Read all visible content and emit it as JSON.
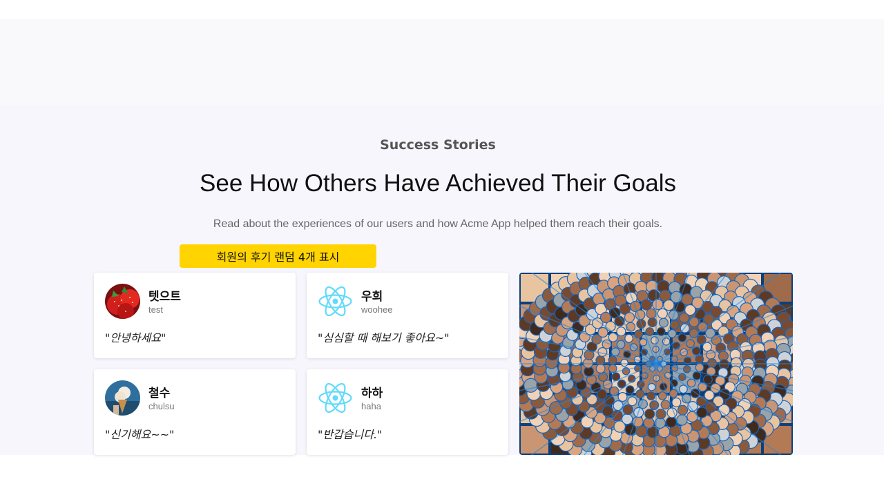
{
  "section": {
    "eyebrow": "Success Stories",
    "headline": "See How Others Have Achieved Their Goals",
    "lead": "Read about the experiences of our users and how Acme App helped them reach their goals.",
    "badge": "회원의 후기 랜덤 4개 표시"
  },
  "reviews": [
    {
      "name": "텟으트",
      "username": "test",
      "quote": "\"안녕하세요\"",
      "avatar": "strawberry-avatar"
    },
    {
      "name": "우희",
      "username": "woohee",
      "quote": "\"심심할 때 해보기 좋아요~\"",
      "avatar": "react-logo-avatar"
    },
    {
      "name": "철수",
      "username": "chulsu",
      "quote": "\"신기해요~~\"",
      "avatar": "ice-cream-avatar"
    },
    {
      "name": "하하",
      "username": "haha",
      "quote": "\"반갑습니다.\"",
      "avatar": "react-logo-avatar"
    }
  ],
  "image": {
    "name": "faces-collage"
  },
  "colors": {
    "badge": "#ffd400",
    "section_bg": "#f7f6fd",
    "react": "#61dafb"
  }
}
